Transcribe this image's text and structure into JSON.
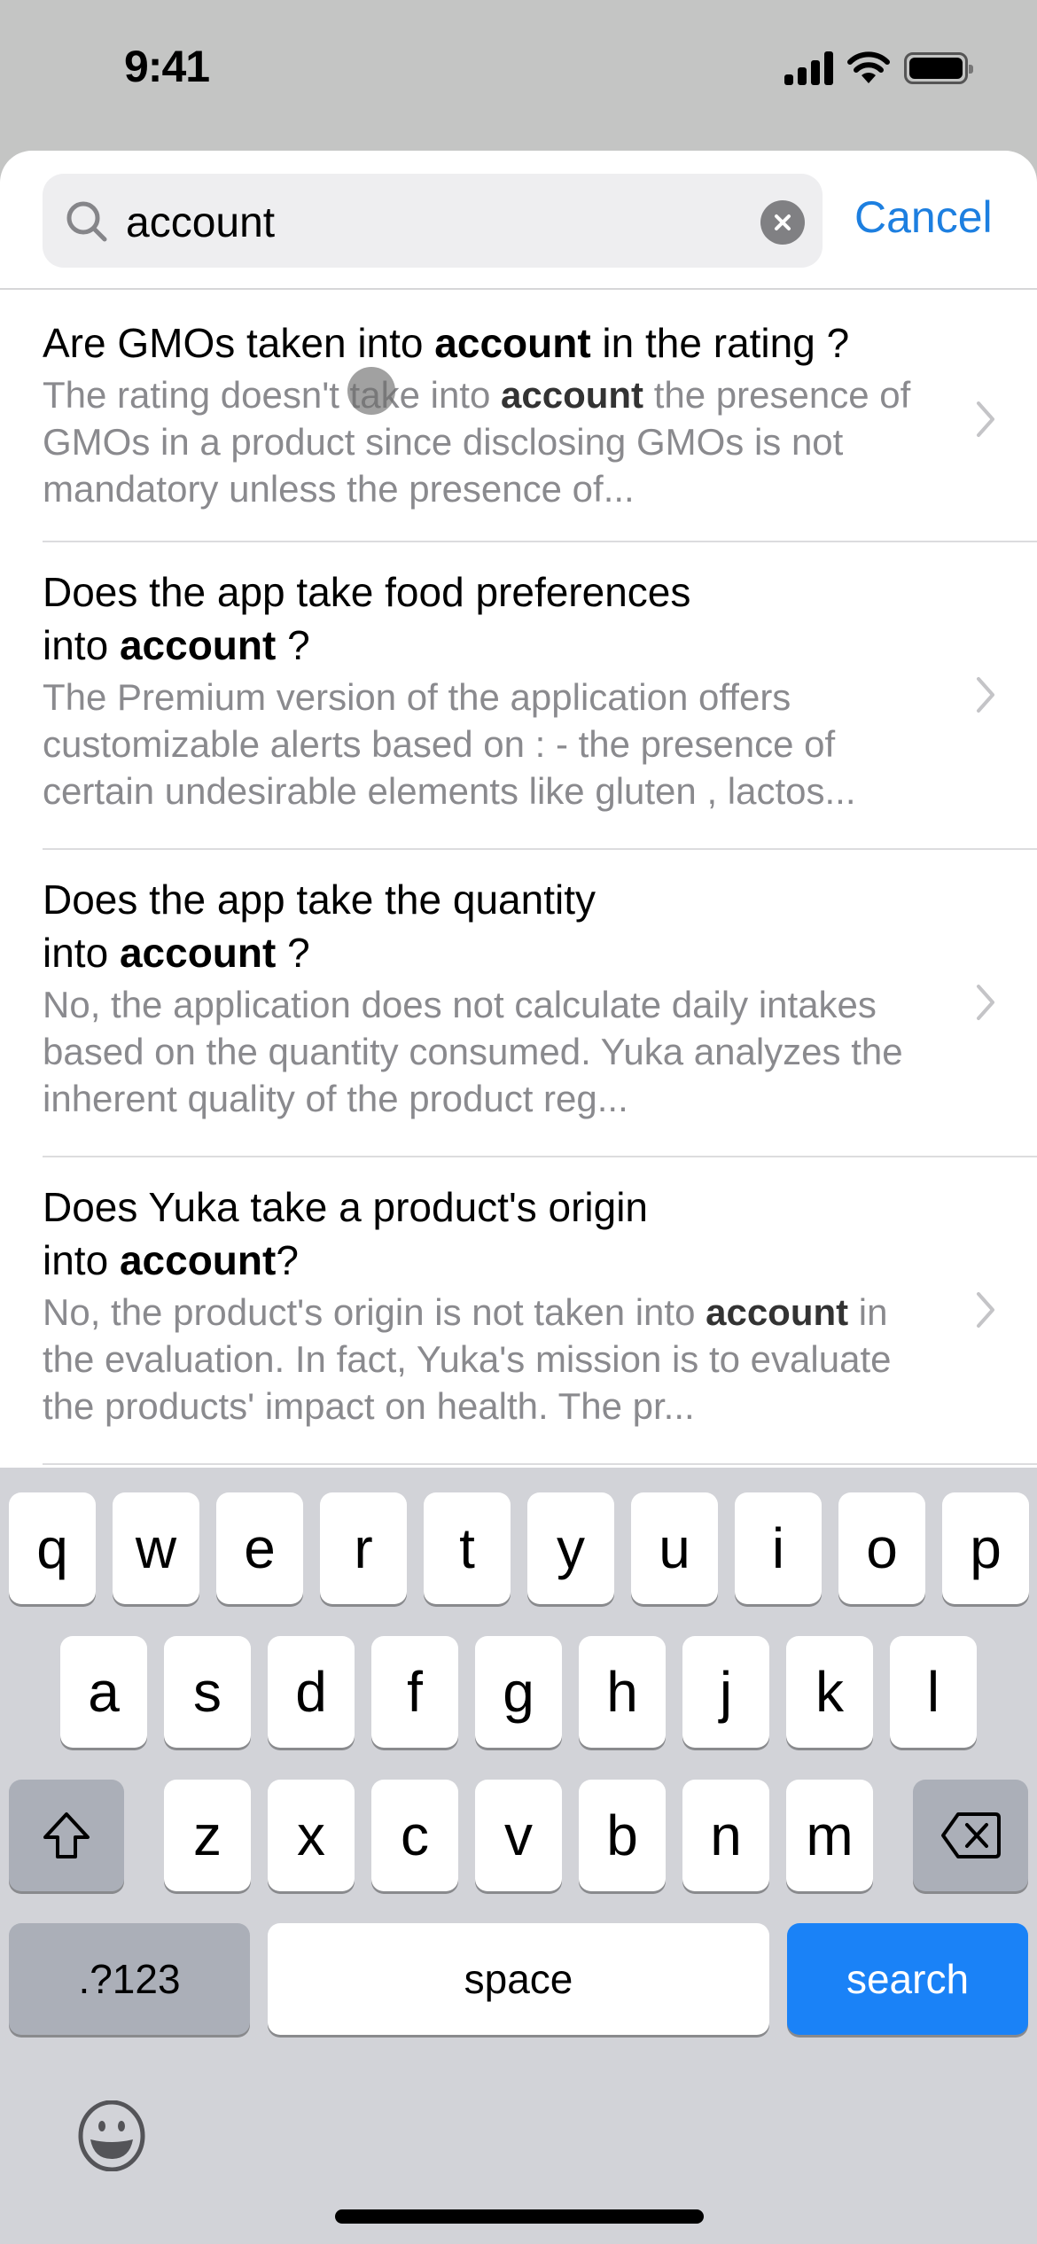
{
  "status_bar": {
    "time": "9:41",
    "icons": [
      "cellular-signal-icon",
      "wifi-icon",
      "battery-icon"
    ]
  },
  "search": {
    "value": "account",
    "clear_icon": "clear-circle-icon",
    "search_icon": "magnifying-glass-icon",
    "cancel_label": "Cancel"
  },
  "results": [
    {
      "title_parts": [
        {
          "text": "Are GMOs taken into ",
          "bold": false
        },
        {
          "text": "account",
          "bold": true
        },
        {
          "text": " in the rating ?",
          "bold": false
        }
      ],
      "body_parts": [
        {
          "text": "The rating doesn't take into ",
          "bold": false
        },
        {
          "text": "account",
          "bold": true
        },
        {
          "text": " the presence of GMOs in a product since disclosing GMOs is not mandatory unless the presence of...",
          "bold": false
        }
      ]
    },
    {
      "title_parts": [
        {
          "text": "Does the app take food preferences",
          "bold": false
        },
        {
          "text": "\n",
          "bold": false
        },
        {
          "text": "into ",
          "bold": false
        },
        {
          "text": "account",
          "bold": true
        },
        {
          "text": " ?",
          "bold": false
        }
      ],
      "body_parts": [
        {
          "text": "The Premium version of the application offers customizable alerts based on : - the presence of certain undesirable elements like gluten , lactos...",
          "bold": false
        }
      ]
    },
    {
      "title_parts": [
        {
          "text": "Does the app take the quantity",
          "bold": false
        },
        {
          "text": "\n",
          "bold": false
        },
        {
          "text": "into ",
          "bold": false
        },
        {
          "text": "account",
          "bold": true
        },
        {
          "text": " ?",
          "bold": false
        }
      ],
      "body_parts": [
        {
          "text": "No, the application does not calculate daily intakes based on the quantity consumed. Yuka analyzes the inherent quality of the product reg...",
          "bold": false
        }
      ]
    },
    {
      "title_parts": [
        {
          "text": "Does Yuka take a product's origin",
          "bold": false
        },
        {
          "text": "\n",
          "bold": false
        },
        {
          "text": "into ",
          "bold": false
        },
        {
          "text": "account",
          "bold": true
        },
        {
          "text": "?",
          "bold": false
        }
      ],
      "body_parts": [
        {
          "text": "No, the product's origin is not taken into ",
          "bold": false
        },
        {
          "text": "account",
          "bold": true
        },
        {
          "text": " in the evaluation. In fact, Yuka's mission is to evaluate the products' impact on health. The pr...",
          "bold": false
        }
      ]
    }
  ],
  "keyboard": {
    "row1": [
      "q",
      "w",
      "e",
      "r",
      "t",
      "y",
      "u",
      "i",
      "o",
      "p"
    ],
    "row2": [
      "a",
      "s",
      "d",
      "f",
      "g",
      "h",
      "j",
      "k",
      "l"
    ],
    "row3": [
      "z",
      "x",
      "c",
      "v",
      "b",
      "n",
      "m"
    ],
    "shift_icon": "shift-arrow-icon",
    "delete_icon": "delete-backspace-icon",
    "numbers_label": ".?123",
    "space_label": "space",
    "search_label": "search",
    "emoji_icon": "emoji-smiley-icon"
  },
  "colors": {
    "accent": "#1d7fe0",
    "search_key": "#1a82f7",
    "secondary_text": "#8a8a8e",
    "keyboard_bg": "#d2d3d8"
  }
}
